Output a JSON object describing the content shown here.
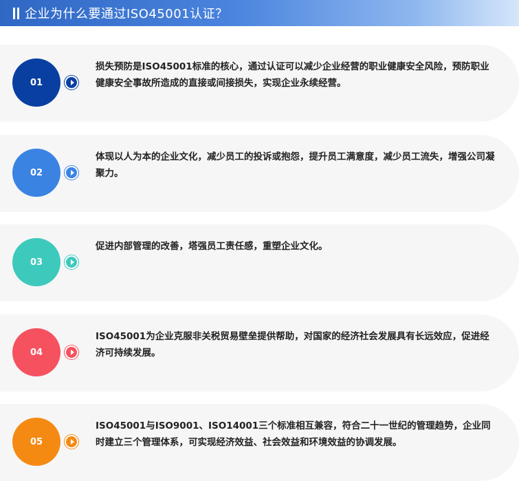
{
  "header": {
    "title": "企业为什么要通过ISO45001认证？",
    "color_start": "#2f67c4",
    "color_end": "#d6e6fb"
  },
  "items": [
    {
      "number": "01",
      "color": "#0a3fa2",
      "text": "损失预防是ISO45001标准的核心，通过认证可以减少企业经营的职业健康安全风险，预防职业健康安全事故所造成的直接或间接损失，实现企业永续经营。"
    },
    {
      "number": "02",
      "color": "#3a83e3",
      "text": "体现以人为本的企业文化，减少员工的投诉或抱怨，提升员工满意度，减少员工流失，增强公司凝聚力。"
    },
    {
      "number": "03",
      "color": "#3ec9bd",
      "text": "促进内部管理的改善，塔强员工责任感，重塑企业文化。"
    },
    {
      "number": "04",
      "color": "#f5515f",
      "text": "ISO45001为企业克服非关税贸易壁垒提供帮助，对国家的经济社会发展具有长远效应，促进经济可持续发展。"
    },
    {
      "number": "05",
      "color": "#f58a12",
      "text": "ISO45001与ISO9001、ISO14001三个标准相互兼容，符合二十一世纪的管理趋势，企业同时建立三个管理体系，可实现经济效益、社会效益和环境效益的协调发展。"
    }
  ]
}
